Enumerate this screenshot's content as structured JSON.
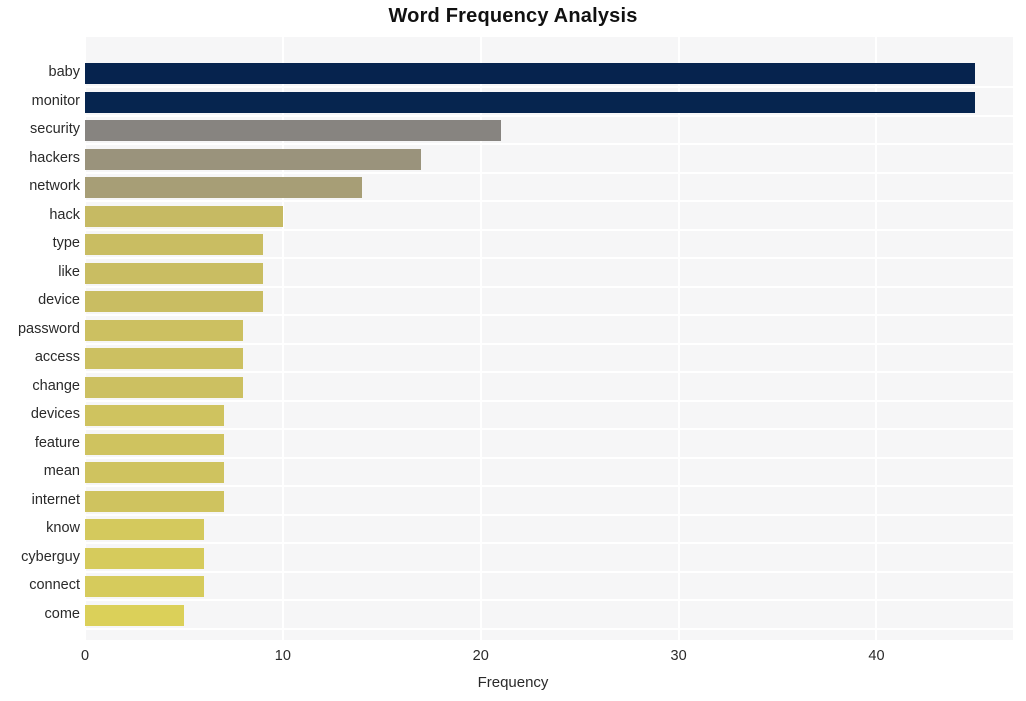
{
  "chart_data": {
    "type": "bar",
    "orientation": "horizontal",
    "title": "Word Frequency Analysis",
    "xlabel": "Frequency",
    "ylabel": "",
    "categories": [
      "baby",
      "monitor",
      "security",
      "hackers",
      "network",
      "hack",
      "type",
      "like",
      "device",
      "password",
      "access",
      "change",
      "devices",
      "feature",
      "mean",
      "internet",
      "know",
      "cyberguy",
      "connect",
      "come"
    ],
    "values": [
      45,
      45,
      21,
      17,
      14,
      10,
      9,
      9,
      9,
      8,
      8,
      8,
      7,
      7,
      7,
      7,
      6,
      6,
      6,
      5
    ],
    "bar_colors": [
      "#06234e",
      "#06254f",
      "#878480",
      "#9a937c",
      "#a79e76",
      "#c6ba63",
      "#c9bd62",
      "#c9bd62",
      "#c9bd62",
      "#ccc061",
      "#ccc061",
      "#ccc061",
      "#cfc35f",
      "#cfc35f",
      "#cfc35f",
      "#cfc35f",
      "#d4c95d",
      "#d6cb5c",
      "#d6cb5c",
      "#dbd059"
    ],
    "xticks": [
      0,
      10,
      20,
      30,
      40
    ],
    "xtick_labels": [
      "0",
      "10",
      "20",
      "30",
      "40"
    ],
    "xlim": [
      0,
      46.9
    ],
    "grid": true,
    "legend": "none",
    "plot_background": "#f6f6f7",
    "gridline_color": "#ffffff",
    "figure_background": "#ffffff"
  }
}
